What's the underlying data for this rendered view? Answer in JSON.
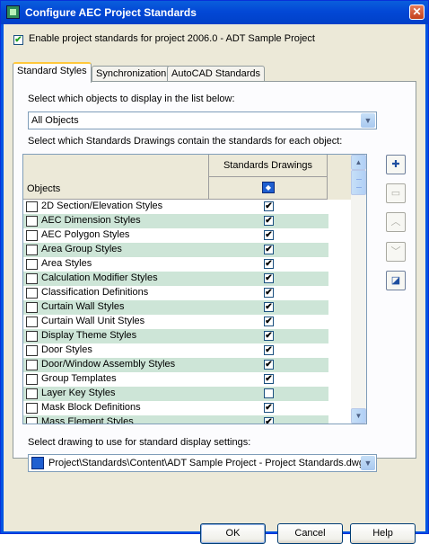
{
  "window": {
    "title": "Configure AEC Project Standards",
    "close_glyph": "✕"
  },
  "enable": {
    "label": "Enable project standards for project 2006.0 - ADT Sample Project",
    "checked": true
  },
  "tabs": [
    {
      "label": "Standard Styles",
      "active": true
    },
    {
      "label": "Synchronization",
      "active": false
    },
    {
      "label": "AutoCAD Standards",
      "active": false
    }
  ],
  "filter": {
    "prompt": "Select which objects to display in the list below:",
    "value": "All Objects"
  },
  "drawings_prompt": "Select which Standards Drawings contain the standards for each object:",
  "list": {
    "col_objects": "Objects",
    "col_standards": "Standards Drawings",
    "rows": [
      {
        "name": "2D Section/Elevation Styles",
        "checked": true
      },
      {
        "name": "AEC Dimension Styles",
        "checked": true
      },
      {
        "name": "AEC Polygon Styles",
        "checked": true
      },
      {
        "name": "Area Group Styles",
        "checked": true
      },
      {
        "name": "Area Styles",
        "checked": true
      },
      {
        "name": "Calculation Modifier Styles",
        "checked": true
      },
      {
        "name": "Classification Definitions",
        "checked": true
      },
      {
        "name": "Curtain Wall Styles",
        "checked": true
      },
      {
        "name": "Curtain Wall Unit Styles",
        "checked": true
      },
      {
        "name": "Display Theme Styles",
        "checked": true
      },
      {
        "name": "Door Styles",
        "checked": true
      },
      {
        "name": "Door/Window Assembly Styles",
        "checked": true
      },
      {
        "name": "Group Templates",
        "checked": true
      },
      {
        "name": "Layer Key Styles",
        "checked": false
      },
      {
        "name": "Mask Block Definitions",
        "checked": true
      },
      {
        "name": "Mass Element Styles",
        "checked": true
      }
    ]
  },
  "display": {
    "prompt": "Select drawing to use for standard display settings:",
    "value": "Project\\Standards\\Content\\ADT Sample Project - Project Standards.dwg"
  },
  "buttons": {
    "ok": "OK",
    "cancel": "Cancel",
    "help": "Help"
  },
  "side_buttons": [
    {
      "name": "add-drawing",
      "icon": "add-drawing-icon",
      "enabled": true
    },
    {
      "name": "remove-drawing",
      "icon": "remove-drawing-icon",
      "enabled": false
    },
    {
      "name": "move-up",
      "icon": "move-up-icon",
      "enabled": false
    },
    {
      "name": "move-down",
      "icon": "move-down-icon",
      "enabled": false
    },
    {
      "name": "set-display",
      "icon": "display-settings-icon",
      "enabled": true
    }
  ],
  "colors": {
    "row_alt": "#cde5d7",
    "titlebar": "#0054e3",
    "face": "#ece9d8"
  }
}
